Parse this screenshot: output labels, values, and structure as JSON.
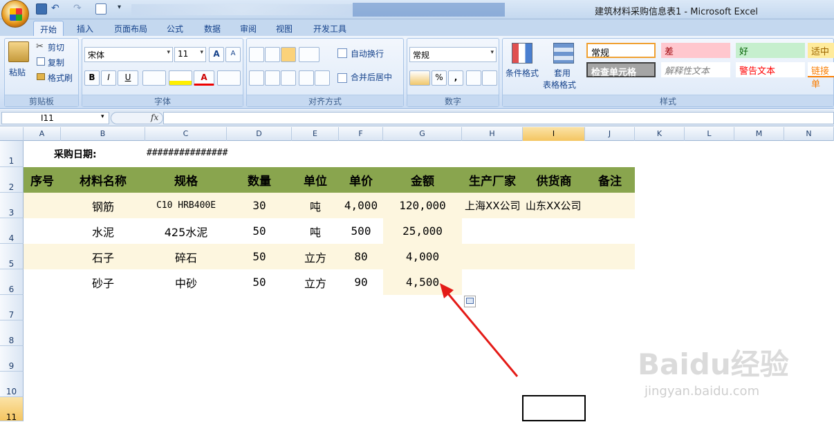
{
  "window": {
    "title": "建筑材料采购信息表1 - Microsoft Excel"
  },
  "tabs": [
    {
      "label": "开始"
    },
    {
      "label": "插入"
    },
    {
      "label": "页面布局"
    },
    {
      "label": "公式"
    },
    {
      "label": "数据"
    },
    {
      "label": "审阅"
    },
    {
      "label": "视图"
    },
    {
      "label": "开发工具"
    }
  ],
  "clipboard": {
    "paste": "粘贴",
    "cut": "剪切",
    "copy": "复制",
    "format_painter": "格式刷",
    "label": "剪贴板"
  },
  "font": {
    "name": "宋体",
    "size": "11",
    "label": "字体",
    "bold": "B",
    "italic": "I",
    "underline": "U",
    "grow": "A",
    "shrink": "A",
    "color_letter": "A"
  },
  "alignment": {
    "wrap": "自动换行",
    "merge": "合并后居中",
    "label": "对齐方式"
  },
  "number": {
    "format": "常规",
    "percent": "%",
    "comma": ",",
    "label": "数字"
  },
  "styles": {
    "conditional": "条件格式",
    "table1": "套用",
    "table2": "表格格式",
    "label": "样式",
    "cells": [
      {
        "text": "常规",
        "bg": "#ffffff",
        "color": "#000000"
      },
      {
        "text": "差",
        "bg": "#ffc7ce",
        "color": "#9c0006"
      },
      {
        "text": "好",
        "bg": "#c6efce",
        "color": "#006100"
      },
      {
        "text": "适中",
        "bg": "#ffeb9c",
        "color": "#9c6500"
      },
      {
        "text": "检查单元格",
        "bg": "#a5a5a5",
        "color": "#ffffff"
      },
      {
        "text": "解释性文本",
        "bg": "#ffffff",
        "color": "#7f7f7f"
      },
      {
        "text": "警告文本",
        "bg": "#ffffff",
        "color": "#ff0000"
      },
      {
        "text": "链接单",
        "bg": "#ffffff",
        "color": "#fa7d00"
      }
    ]
  },
  "namebox": "I11",
  "fx": "fx",
  "columns": [
    "A",
    "B",
    "C",
    "D",
    "E",
    "F",
    "G",
    "H",
    "I",
    "J",
    "K",
    "L",
    "M",
    "N"
  ],
  "rows": [
    "1",
    "2",
    "3",
    "4",
    "5",
    "6",
    "7",
    "8",
    "9",
    "10",
    "11"
  ],
  "sheet": {
    "date_label": "采购日期:",
    "date_value": "###############",
    "headers": [
      "序号",
      "材料名称",
      "规格",
      "数量",
      "单位",
      "单价",
      "金额",
      "生产厂家",
      "供货商",
      "备注"
    ],
    "data": [
      [
        "",
        "钢筋",
        "C10 HRB400E",
        "30",
        "吨",
        "4,000",
        "120,000",
        "上海XX公司",
        "山东XX公司",
        ""
      ],
      [
        "",
        "水泥",
        "425水泥",
        "50",
        "吨",
        "500",
        "25,000",
        "",
        "",
        ""
      ],
      [
        "",
        "石子",
        "碎石",
        "50",
        "立方",
        "80",
        "4,000",
        "",
        "",
        ""
      ],
      [
        "",
        "砂子",
        "中砂",
        "50",
        "立方",
        "90",
        "4,500",
        "",
        "",
        ""
      ]
    ]
  },
  "watermark": {
    "brand": "Baidu经验",
    "url": "jingyan.baidu.com"
  }
}
